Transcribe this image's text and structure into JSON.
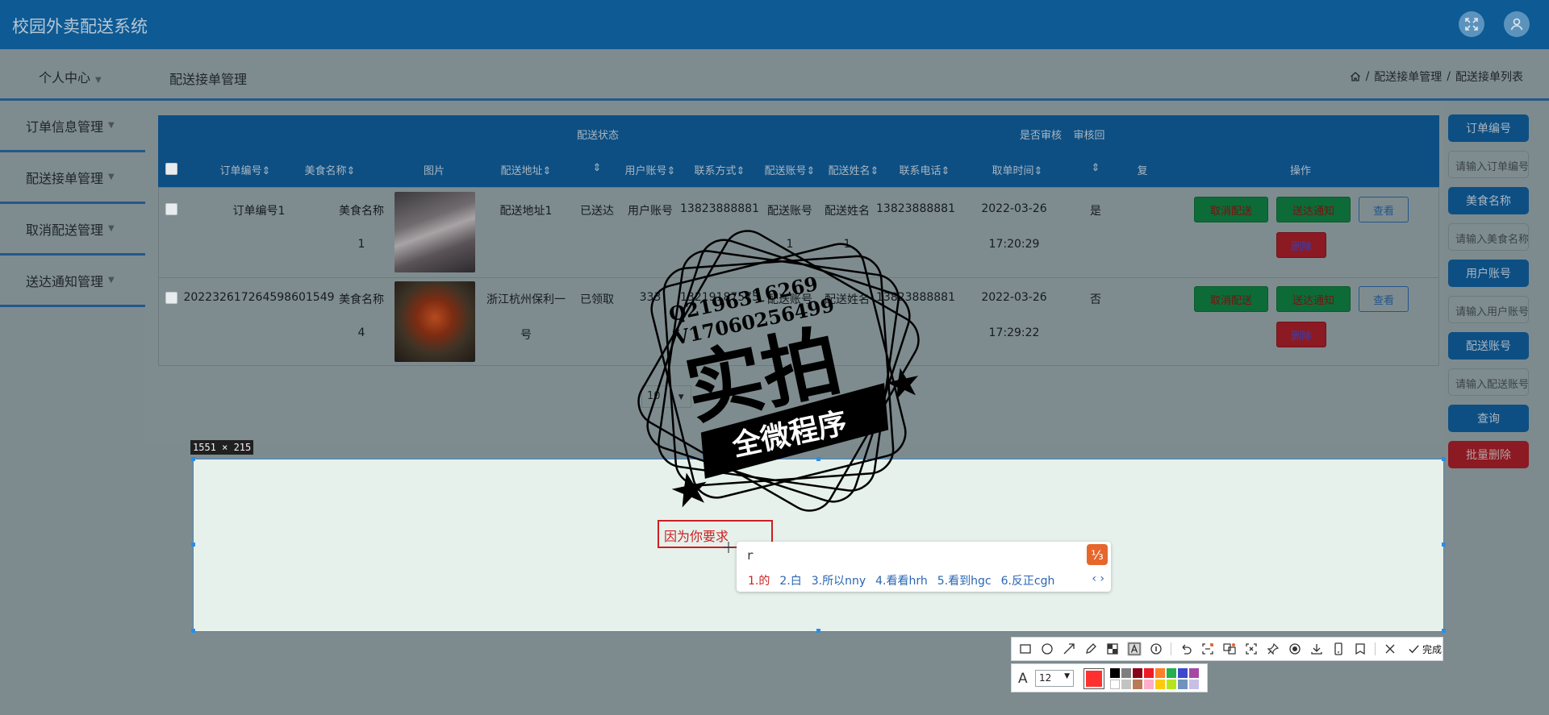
{
  "app": {
    "title": "校园外卖配送系统"
  },
  "subbar": {
    "personal_center": "个人中心",
    "page_title": "配送接单管理",
    "breadcrumb": [
      "配送接单管理",
      "配送接单列表"
    ],
    "breadcrumb_sep": "/"
  },
  "sidebar": {
    "items": [
      {
        "label": "订单信息管理"
      },
      {
        "label": "配送接单管理"
      },
      {
        "label": "取消配送管理"
      },
      {
        "label": "送达通知管理"
      }
    ]
  },
  "table": {
    "group_headers": {
      "delivery_status": "配送状态",
      "is_reviewed": "是否审核",
      "review_reply": "审核回"
    },
    "columns": [
      "订单编号",
      "美食名称",
      "图片",
      "配送地址",
      "",
      "用户账号",
      "联系方式",
      "配送账号",
      "配送姓名",
      "联系电话",
      "取单时间",
      "",
      "复",
      "操作"
    ],
    "sort_mark": "⇕",
    "rows": [
      {
        "order_no": "订单编号1",
        "food_line1": "美食名称",
        "food_line2": "1",
        "address_line1": "配送地址1",
        "address_line2": "",
        "status": "已送达",
        "user_account": "用户账号",
        "contact": "13823888881",
        "courier_account": "配送账号",
        "courier_account_line2": "1",
        "courier_name": "配送姓名",
        "courier_name_line2": "1",
        "courier_phone": "13823888881",
        "pickup_date": "2022-03-26",
        "pickup_time": "17:20:29",
        "reviewed": "是"
      },
      {
        "order_no": "20223261726459860154",
        "order_no_suffix": "9",
        "food_line1": "美食名称",
        "food_line2": "4",
        "address_line1": "浙江杭州保利一",
        "address_line2": "号",
        "status": "已领取",
        "user_account": "333",
        "contact": "13219187575",
        "courier_account": "配送账号",
        "courier_name": "配送姓名",
        "courier_phone": "13823888881",
        "pickup_date": "2022-03-26",
        "pickup_time": "17:29:22",
        "reviewed": "否"
      }
    ],
    "actions": {
      "cancel": "取消配送",
      "notify": "送达通知",
      "view": "查看",
      "delete": "删除"
    }
  },
  "pager": {
    "page_size": "10"
  },
  "search": {
    "order_no_btn": "订单编号",
    "order_no_ph": "请输入订单编号",
    "food_btn": "美食名称",
    "food_ph": "请输入美食名称",
    "user_btn": "用户账号",
    "user_ph": "请输入用户账号",
    "courier_btn": "配送账号",
    "courier_ph": "请输入配送账号",
    "query_btn": "查询",
    "batch_delete_btn": "批量删除"
  },
  "watermark": {
    "qq": "Q2196316269",
    "wechat": "V17060256499",
    "main": "实拍",
    "banner": "全微程序"
  },
  "capture": {
    "size_label": "1551 × 215",
    "text_annotation": "因为你要求",
    "ime_input": "r",
    "ime_candidates": [
      "1.的",
      "2.白",
      "3.所以nny",
      "4.看看hrh",
      "5.看到hgc",
      "6.反正cgh"
    ],
    "ime_nav": "‹ ›",
    "done_label": "完成",
    "font_size": "12",
    "current_color": "#ff3030",
    "palette": [
      "#000000",
      "#7f7f7f",
      "#880015",
      "#ed1c24",
      "#ff7f27",
      "#22b14c",
      "#3f48cc",
      "#a349a4",
      "#ffffff",
      "#c3c3c3",
      "#b97a57",
      "#ffaec9",
      "#ffc90e",
      "#b5e61d",
      "#7092be",
      "#c8bfe7"
    ]
  }
}
